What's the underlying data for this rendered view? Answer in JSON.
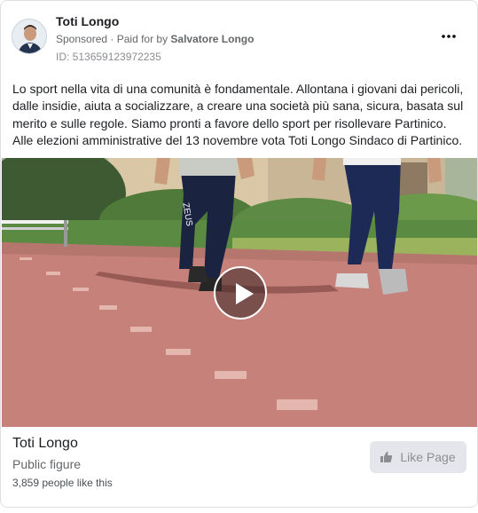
{
  "post": {
    "page_name": "Toti Longo",
    "sponsored": "Sponsored",
    "paid_for_prefix": "· Paid for by ",
    "paid_for_name": "Salvatore Longo",
    "ad_id": "ID: 513659123972235",
    "body": "Lo sport nella vita di una comunità è fondamentale. Allontana i giovani dai pericoli, dalle insidie, aiuta a socializzare, a creare una società più sana, sicura, basata sul merito e sulle regole. Siamo pronti a favore dello sport per risollevare Partinico. Alle elezioni amministrative del 13 novembre vota Toti Longo Sindaco di Partinico.",
    "more_icon": "more-horizontal-icon"
  },
  "media": {
    "type": "video",
    "play_icon": "play-icon"
  },
  "footer": {
    "page_name": "Toti Longo",
    "category": "Public figure",
    "likes": "3,859 people like this",
    "like_button_label": "Like Page",
    "like_icon": "thumbs-up-icon"
  }
}
